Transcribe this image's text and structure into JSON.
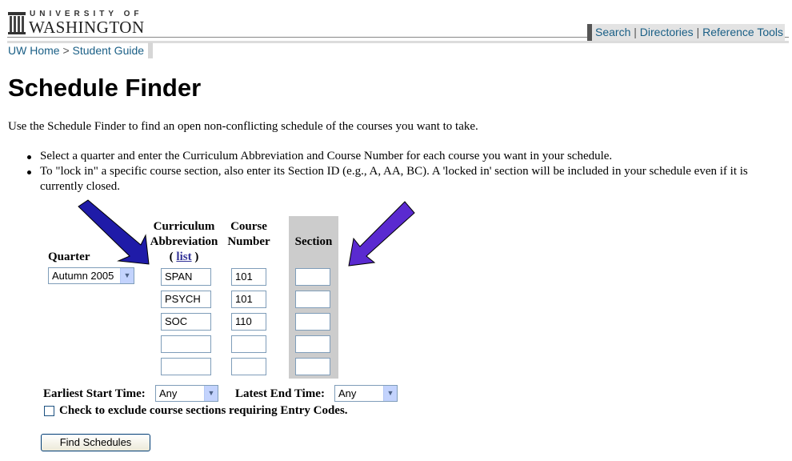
{
  "header": {
    "logo_line1": "UNIVERSITY OF",
    "logo_line2": "WASHINGTON",
    "toolbar": {
      "search": "Search",
      "directories": "Directories",
      "reference_tools": "Reference Tools",
      "separator": " | "
    },
    "breadcrumb": {
      "home": "UW Home",
      "separator": " > ",
      "student_guide": "Student Guide"
    }
  },
  "page": {
    "title": "Schedule Finder",
    "intro": "Use the Schedule Finder to find an open non-conflicting schedule of the courses you want to take.",
    "instructions": [
      "Select a quarter and enter the Curriculum Abbreviation and Course Number for each course you want in your schedule.",
      "To \"lock in\" a specific course section, also enter its Section ID (e.g., A, AA, BC). A 'locked in' section will be included in your schedule even if it is currently closed."
    ]
  },
  "form": {
    "headers": {
      "quarter": "Quarter",
      "curriculum_line1": "Curriculum",
      "curriculum_line2": "Abbreviation",
      "list_open": "( ",
      "list_link": "list",
      "list_close": " )",
      "course_line1": "Course",
      "course_line2": "Number",
      "section": "Section"
    },
    "quarter_selected": "Autumn 2005",
    "rows": [
      {
        "curriculum": "SPAN",
        "number": "101",
        "section": ""
      },
      {
        "curriculum": "PSYCH",
        "number": "101",
        "section": ""
      },
      {
        "curriculum": "SOC",
        "number": "110",
        "section": ""
      },
      {
        "curriculum": "",
        "number": "",
        "section": ""
      },
      {
        "curriculum": "",
        "number": "",
        "section": ""
      }
    ],
    "earliest_label": "Earliest Start Time:",
    "earliest_value": "Any",
    "latest_label": "Latest End Time:",
    "latest_value": "Any",
    "checkbox_label": "Check to exclude course sections requiring Entry Codes.",
    "submit_label": "Find Schedules"
  },
  "colors": {
    "link": "#1a5f86",
    "section_column": "#cccccc",
    "annotation_arrow_left": "#1f1ba8",
    "annotation_arrow_right": "#5a2ad0"
  }
}
